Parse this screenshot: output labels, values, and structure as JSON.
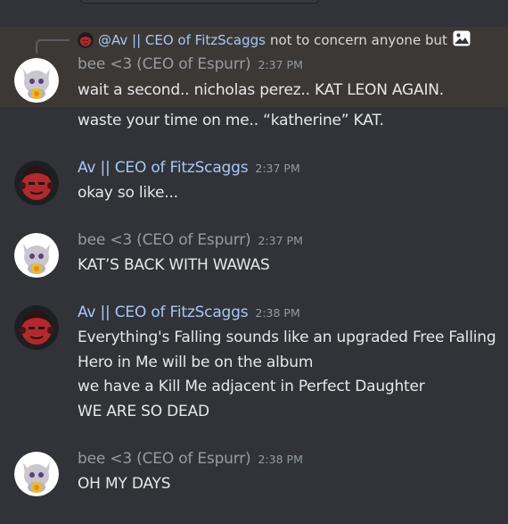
{
  "reply": {
    "mention": "@Av || CEO of FitzScaggs",
    "preview": "not to concern anyone but",
    "icon": "image-icon"
  },
  "groups": [
    {
      "user": "bee <3 (CEO of Espurr)",
      "time": "2:37 PM",
      "avatar": "espurr-avatar",
      "lines": [
        "wait a second.. nicholas perez.. KAT LEON AGAIN.",
        "waste your time on me.. “katherine” KAT."
      ]
    },
    {
      "user": "Av || CEO of FitzScaggs",
      "time": "2:37 PM",
      "avatar": "red-face-avatar",
      "lines": [
        "okay so like..."
      ]
    },
    {
      "user": "bee <3 (CEO of Espurr)",
      "time": "2:37 PM",
      "avatar": "espurr-avatar",
      "lines": [
        "KAT’S BACK WITH WAWAS"
      ]
    },
    {
      "user": "Av || CEO of FitzScaggs",
      "time": "2:38 PM",
      "avatar": "red-face-avatar",
      "lines": [
        "Everything's Falling sounds like an upgraded Free Falling",
        "Hero in Me will be on the album",
        "we have a Kill Me adjacent in Perfect Daughter",
        "WE ARE SO DEAD"
      ]
    },
    {
      "user": "bee <3 (CEO of Espurr)",
      "time": "2:38 PM",
      "avatar": "espurr-avatar",
      "lines": [
        "OH MY DAYS"
      ]
    }
  ],
  "colors": {
    "background": "#313338",
    "highlight": "#3b3836",
    "av_name": "#a7c7f5",
    "bee_name": "#9a9ba0",
    "timestamp": "#949ba4",
    "text": "#e6e7ea"
  }
}
